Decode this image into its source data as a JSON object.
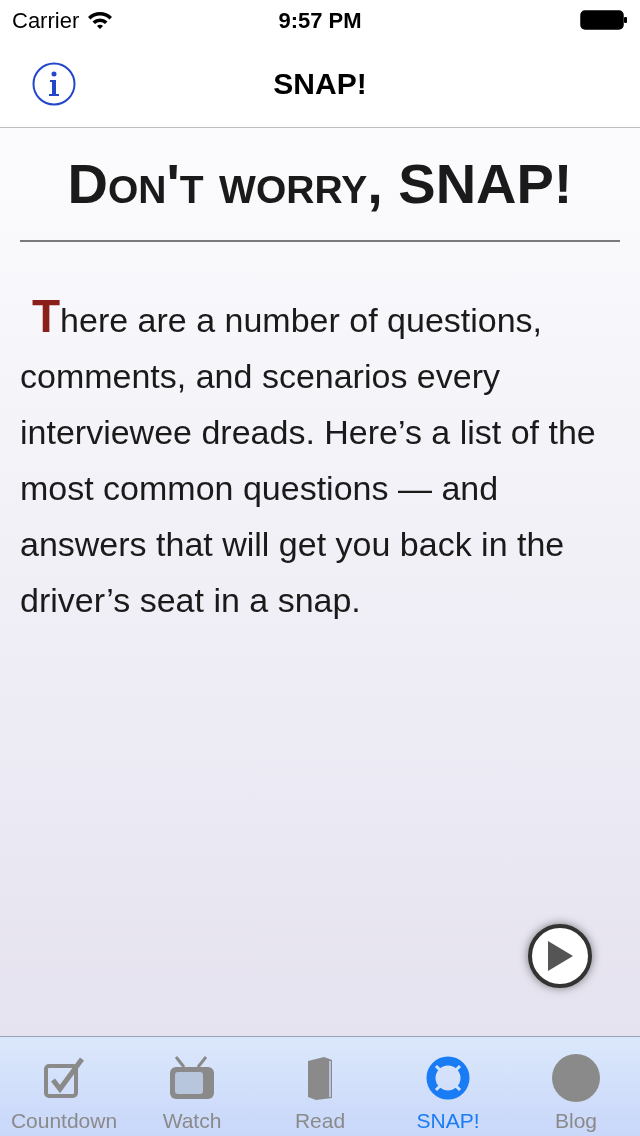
{
  "status_bar": {
    "carrier": "Carrier",
    "time": "9:57 PM"
  },
  "nav_bar": {
    "title": "SNAP!"
  },
  "article": {
    "heading": "Don't worry, SNAP!",
    "body": "There are a number of questions, comments, and scenarios every interviewee dreads. Here’s a list of the most common questions — and answers that will get you back in the driver’s seat in a snap."
  },
  "tabs": [
    {
      "label": "Countdown",
      "selected": false
    },
    {
      "label": "Watch",
      "selected": false
    },
    {
      "label": "Read",
      "selected": false
    },
    {
      "label": "SNAP!",
      "selected": true
    },
    {
      "label": "Blog",
      "selected": false
    }
  ]
}
